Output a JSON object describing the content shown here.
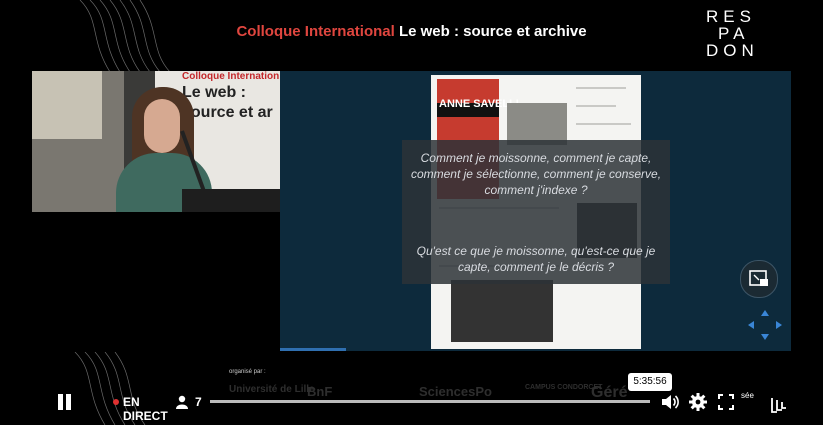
{
  "header": {
    "title_highlight": "Colloque International",
    "title_rest": "Le web : source et archive",
    "logo_lines": [
      "RES",
      "PA",
      "DON"
    ]
  },
  "speaker_video": {
    "board_line1": "Colloque Internation",
    "board_line2": "Le web :",
    "board_line3": "source et ar"
  },
  "slide": {
    "poster_text": "ANNE SAVELLI",
    "question_1": "Comment je moissonne, comment je capte, comment je sélectionne, comment je conserve, comment j'indexe ?",
    "question_2": "Qu'est ce que je moissonne, qu'est-ce que je capte, comment je le décris ?"
  },
  "sponsors": {
    "label": "organisé par :",
    "names": [
      "Université de Lille",
      "BnF",
      "SciencesPo",
      "CAMPUS CONDORCET",
      "Géré"
    ]
  },
  "player": {
    "live_line1": "EN",
    "live_line2": "DIRECT",
    "viewer_count": "7",
    "time_tooltip": "5:35:56",
    "progress_fraction": 1.0,
    "partial_label": "sée",
    "colors": {
      "live_red": "#e03030",
      "accent_red": "#e0463f"
    },
    "icons": [
      "pause-icon",
      "person-icon",
      "volume-icon",
      "gear-icon",
      "fullscreen-icon",
      "lille-logo-icon",
      "picture-in-picture-icon",
      "arrows-navigation-icon"
    ]
  }
}
